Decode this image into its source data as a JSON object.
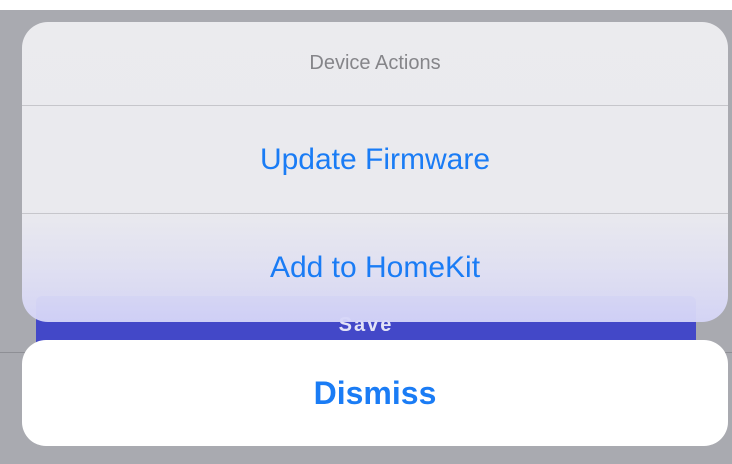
{
  "background": {
    "primary_button_label": "Save"
  },
  "action_sheet": {
    "title": "Device Actions",
    "actions": [
      {
        "label": "Update Firmware"
      },
      {
        "label": "Add to HomeKit"
      }
    ],
    "cancel_label": "Dismiss"
  },
  "colors": {
    "accent": "#1a7cf5",
    "sheet_background": "#ececf0",
    "cancel_background": "#ffffff",
    "title_text": "#858589",
    "background_button": "#4348c8"
  }
}
